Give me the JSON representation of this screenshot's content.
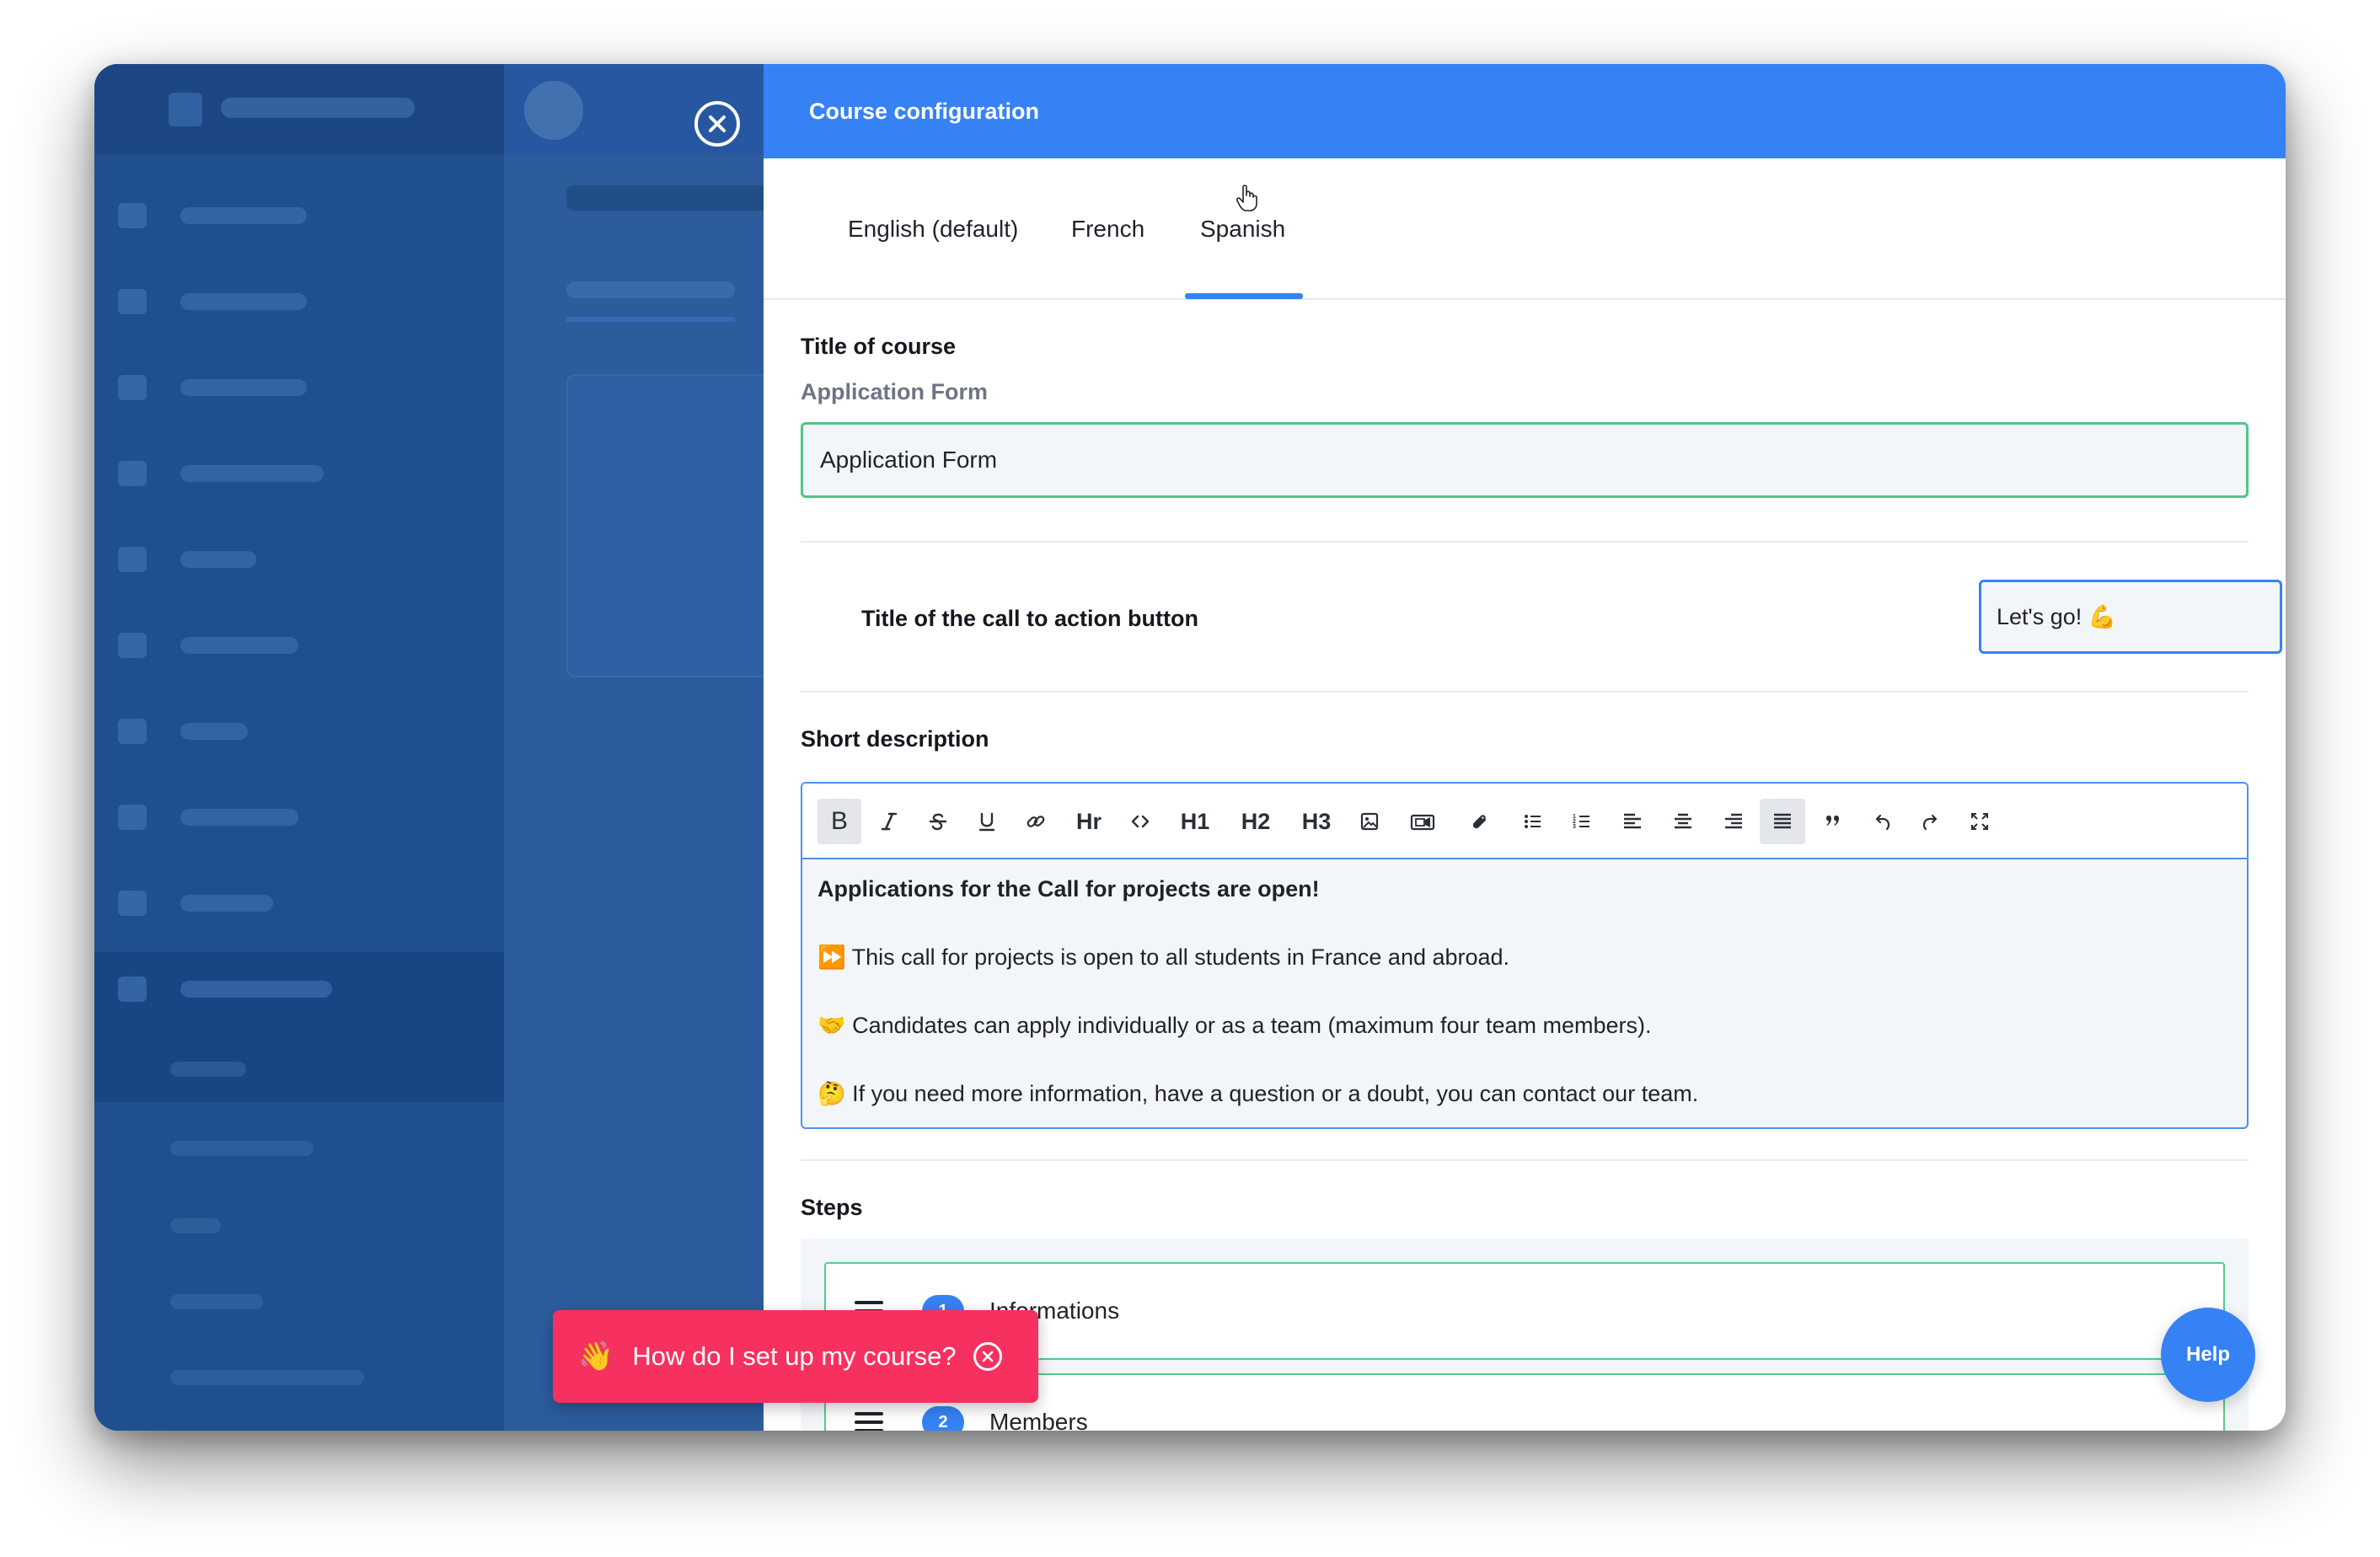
{
  "drawer": {
    "title": "Course configuration",
    "close_icon": "close-circle-icon"
  },
  "tabs": [
    {
      "label": "English (default)",
      "active": false
    },
    {
      "label": "French",
      "active": false
    },
    {
      "label": "Spanish",
      "active": true
    }
  ],
  "course": {
    "title_label": "Title of course",
    "default_title": "Application Form",
    "title_value": "Application Form",
    "cta_label": "Title of the call to action button",
    "cta_value": "Let's go! 💪",
    "short_description_label": "Short description"
  },
  "editor": {
    "toolbar": [
      {
        "name": "bold",
        "label": "B",
        "active": true
      },
      {
        "name": "italic",
        "icon": "italic-icon"
      },
      {
        "name": "strikethrough",
        "icon": "strikethrough-icon"
      },
      {
        "name": "underline",
        "icon": "underline-icon"
      },
      {
        "name": "link",
        "icon": "link-icon"
      },
      {
        "name": "hr",
        "label": "Hr"
      },
      {
        "name": "code",
        "icon": "code-icon"
      },
      {
        "name": "h1",
        "label": "H1"
      },
      {
        "name": "h2",
        "label": "H2"
      },
      {
        "name": "h3",
        "label": "H3"
      },
      {
        "name": "image",
        "icon": "image-icon"
      },
      {
        "name": "video",
        "icon": "video-icon"
      },
      {
        "name": "attachment",
        "icon": "paperclip-icon"
      },
      {
        "name": "bullet-list",
        "icon": "bullet-list-icon"
      },
      {
        "name": "ordered-list",
        "icon": "ordered-list-icon"
      },
      {
        "name": "align-left",
        "icon": "align-left-icon"
      },
      {
        "name": "align-center",
        "icon": "align-center-icon"
      },
      {
        "name": "align-right",
        "icon": "align-right-icon"
      },
      {
        "name": "align-justify",
        "icon": "align-justify-icon",
        "active": true
      },
      {
        "name": "quote",
        "icon": "quote-icon"
      },
      {
        "name": "undo",
        "icon": "undo-icon"
      },
      {
        "name": "redo",
        "icon": "redo-icon"
      },
      {
        "name": "fullscreen",
        "icon": "fullscreen-icon"
      }
    ],
    "content": {
      "heading": "Applications for the Call for projects are open!",
      "line1": "⏩ This call for projects is open to all students in France and abroad.",
      "line2": "🤝 Candidates can apply individually or as a team (maximum four team members).",
      "line3": "🤔 If you need more information, have a question or a doubt, you can contact our team."
    }
  },
  "steps": {
    "label": "Steps",
    "items": [
      {
        "number": "1",
        "label": "Informations"
      },
      {
        "number": "2",
        "label": "Members"
      }
    ]
  },
  "help_prompt": {
    "emoji": "👋",
    "text": "How do I set up my course?"
  },
  "help_button": {
    "label": "Help"
  },
  "colors": {
    "accent": "#3682f5",
    "success_border": "#52c487",
    "help_prompt": "#f7315f",
    "overlay": "#2c5c9c"
  }
}
